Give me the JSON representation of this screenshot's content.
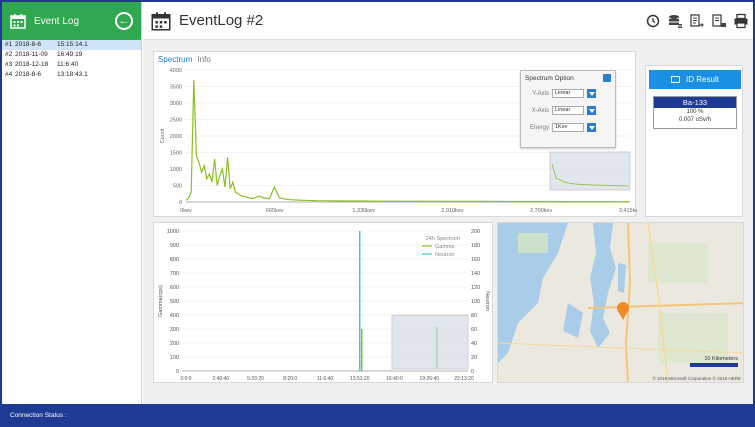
{
  "sidebar": {
    "title": "Event Log",
    "items": [
      {
        "idx": "#1",
        "date": "2018-8-6",
        "time": "15:15:14.1"
      },
      {
        "idx": "#2",
        "date": "2018-11-09",
        "time": "16:49:19"
      },
      {
        "idx": "#3",
        "date": "2018-12-18",
        "time": "11:6:40"
      },
      {
        "idx": "#4",
        "date": "2018-8-6",
        "time": "13:18:43.1"
      }
    ]
  },
  "header": {
    "title": "EventLog #2",
    "tools": [
      "refresh-icon",
      "database-list-icon",
      "export-icon",
      "export-alt-icon",
      "print-icon"
    ]
  },
  "tabs": [
    {
      "label": "Spectrum",
      "active": true
    },
    {
      "label": "Info",
      "active": false
    }
  ],
  "spectrum_option": {
    "title": "Spectrum Option",
    "rows": [
      {
        "label": "Y-Axis",
        "value": "Linear"
      },
      {
        "label": "X-Axis",
        "value": "Linear"
      },
      {
        "label": "Energy",
        "value": "1Kev"
      }
    ]
  },
  "id_result": {
    "button_label": "ID Result",
    "isotope": "Ba-133",
    "confidence": "100 %",
    "dose": "0.007 uSv/h"
  },
  "map": {
    "scale_label": "10 Kilometers",
    "attribution": "© 2019 Microsoft Corporation  © 2019 HERE"
  },
  "status": {
    "label": "Connection Status :"
  },
  "chart_data": [
    {
      "type": "line",
      "title": "",
      "xlabel": "",
      "ylabel": "Count",
      "ylim": [
        0,
        4000
      ],
      "yticks": [
        "4000",
        "3500",
        "3000",
        "2500",
        "2000",
        "1500",
        "1000",
        "500",
        "0"
      ],
      "xticks": [
        "0kev",
        "665kev",
        "1,330kev",
        "2,010kev",
        "2,700kev",
        "3,415kev"
      ],
      "color": "#8cbf26",
      "series": [
        {
          "x": [
            0,
            20,
            40,
            60,
            80,
            100,
            120,
            140,
            160,
            180,
            200,
            220,
            240,
            260,
            280,
            300,
            320,
            340,
            360,
            380,
            400,
            430,
            460,
            490,
            520,
            560,
            600,
            640,
            680,
            720,
            760,
            800,
            850,
            900,
            950,
            1000,
            1100,
            1200,
            1330,
            1500,
            1700,
            2010,
            2300,
            2700,
            3000,
            3415
          ],
          "values": [
            50,
            120,
            300,
            3700,
            1400,
            1200,
            900,
            1100,
            700,
            850,
            600,
            1300,
            500,
            800,
            1000,
            450,
            1350,
            400,
            600,
            300,
            250,
            180,
            160,
            120,
            110,
            180,
            120,
            100,
            450,
            120,
            90,
            70,
            60,
            50,
            45,
            40,
            35,
            30,
            30,
            25,
            25,
            20,
            18,
            15,
            12,
            10
          ]
        }
      ]
    },
    {
      "type": "line",
      "title": "",
      "xlabel": "",
      "ylabel": "Gamma(cps)",
      "y2label": "Neutron",
      "ylim": [
        0,
        1000
      ],
      "y2lim": [
        0,
        200
      ],
      "yticks": [
        "1000",
        "900",
        "800",
        "700",
        "600",
        "500",
        "400",
        "300",
        "200",
        "100",
        "0"
      ],
      "y2ticks": [
        "200",
        "180",
        "160",
        "140",
        "120",
        "100",
        "80",
        "60",
        "40",
        "20",
        "0"
      ],
      "xticks": [
        "0:0:0",
        "2:46:40",
        "5:33:20",
        "8:20:0",
        "11:6:40",
        "13:53:20",
        "16:40:0",
        "19:26:40",
        "22:13:20"
      ],
      "legend_title": "24h Spectrum",
      "series": [
        {
          "name": "Gamma",
          "color": "#8cbf26",
          "spike_at": "13:53:20",
          "value": 300
        },
        {
          "name": "Neutron",
          "color": "#3cc6d6",
          "spike_at": "13:53:20",
          "value": 1000
        }
      ]
    }
  ]
}
